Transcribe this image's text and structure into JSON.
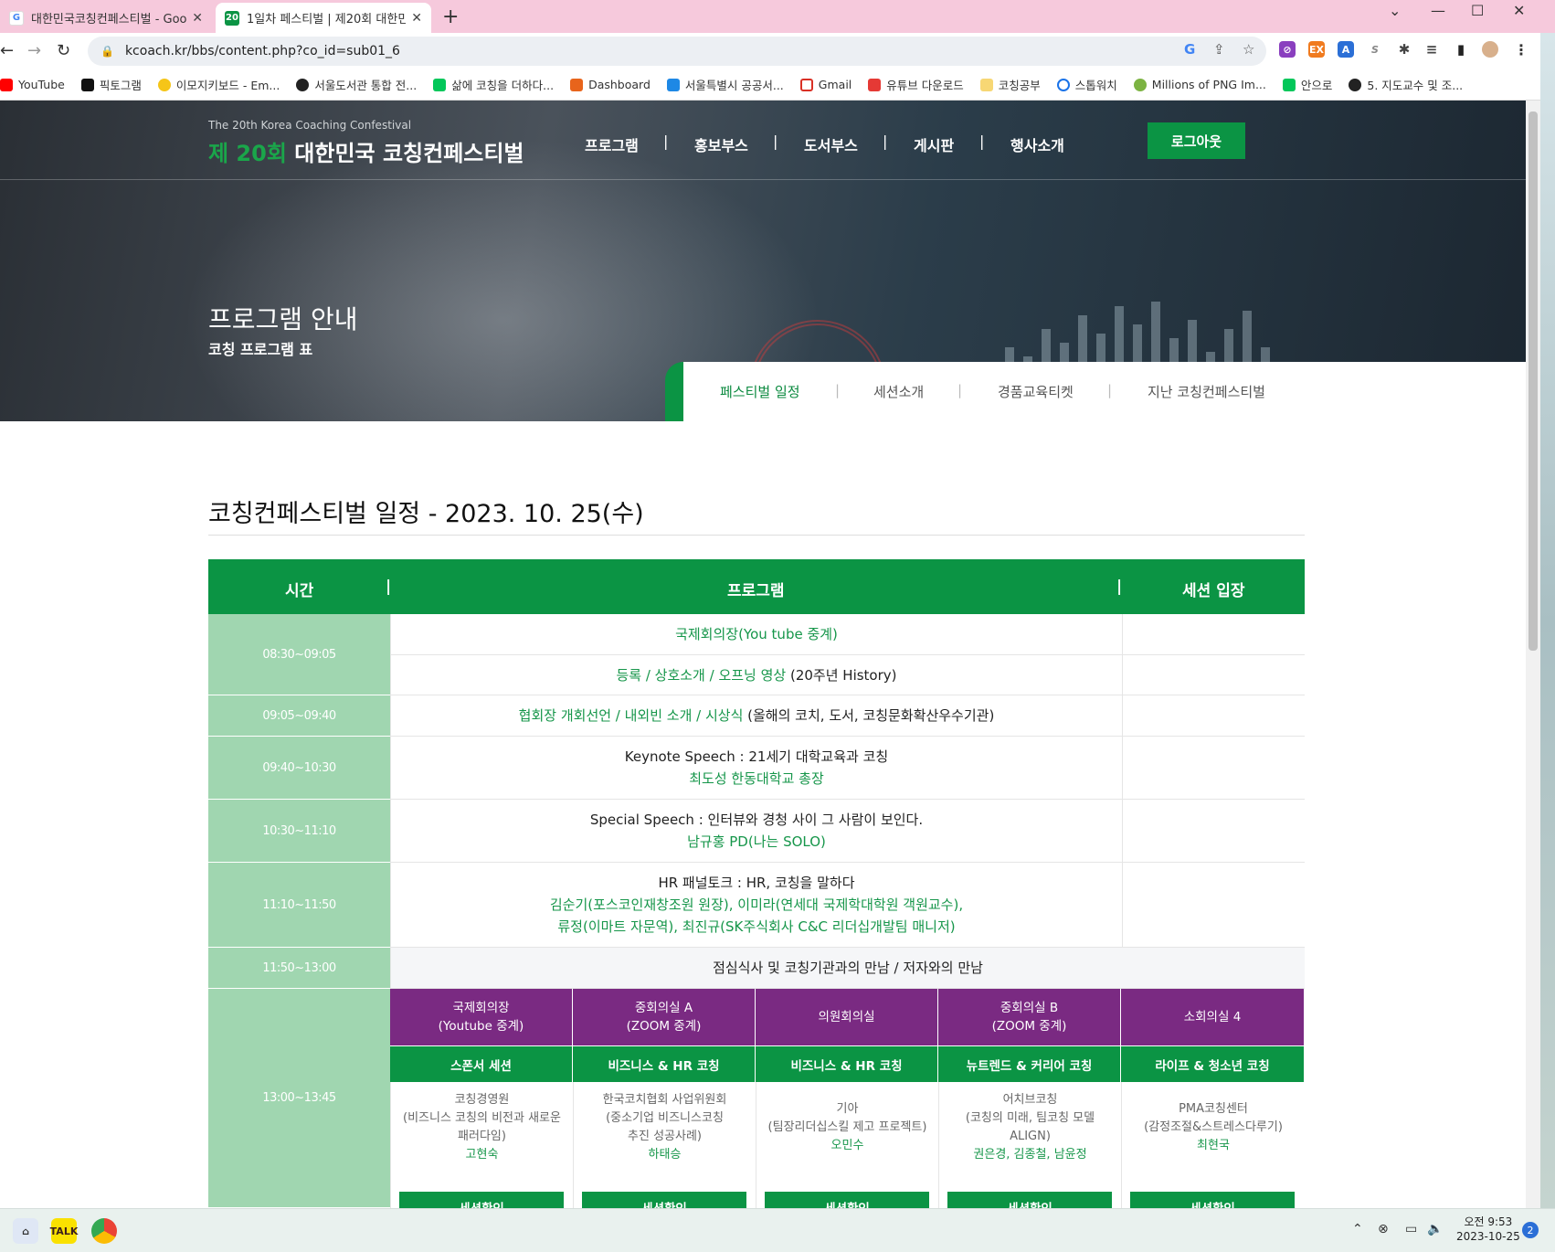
{
  "browser": {
    "tabs": [
      {
        "title": "대한민국코칭컨페스티벌 - Goo",
        "favicon": "G",
        "active": false
      },
      {
        "title": "1일차 페스티벌 | 제20회 대한민",
        "favicon": "20",
        "active": true
      }
    ],
    "new_tab": "+",
    "url": "kcoach.kr/bbs/content.php?co_id=sub01_6",
    "bookmarks": [
      "YouTube",
      "픽토그램",
      "이모지키보드 - Em...",
      "서울도서관 통합 전...",
      "삶에 코칭을 더하다...",
      "Dashboard",
      "서울특별시 공공서...",
      "Gmail",
      "유튜브 다운로드",
      "코칭공부",
      "스톱워치",
      "Millions of PNG Im...",
      "안으로",
      "5. 지도교수 및 조..."
    ],
    "extensions": [
      "G",
      "EX",
      "A",
      "S"
    ]
  },
  "site": {
    "brand_sub": "The 20th Korea Coaching Confestival",
    "brand_num": "제 20회",
    "brand_name": "대한민국 코칭컨페스티벌",
    "nav": [
      "프로그램",
      "홍보부스",
      "도서부스",
      "게시판",
      "행사소개"
    ],
    "nav_sep": "|",
    "logout": "로그아웃",
    "hero_title": "프로그램 안내",
    "hero_sub": "코칭 프로그램 표",
    "subnav": [
      "페스티벌 일정",
      "세션소개",
      "경품교육티켓",
      "지난 코칭컨페스티벌"
    ],
    "subnav_active": "페스티벌 일정"
  },
  "schedule": {
    "title": "코칭컨페스티벌 일정 - 2023. 10. 25(수)",
    "headers": [
      "시간",
      "프로그램",
      "세션 입장"
    ],
    "header_sep": "|",
    "rows": [
      {
        "time": "08:30~09:05",
        "lines": [
          "국제회의장(You tube 중계)"
        ],
        "second": [
          "등록 / 상호소개 / 오프닝 영상",
          " (20주년 History)"
        ]
      },
      {
        "time": "09:05~09:40",
        "lines": [
          "협회장 개회선언 / 내외빈 소개 / 시상식",
          " (올해의 코치, 도서, 코칭문화확산우수기관)"
        ]
      },
      {
        "time": "09:40~10:30",
        "lines": [
          "Keynote Speech : 21세기 대학교육과 코칭",
          "최도성 한동대학교 총장"
        ]
      },
      {
        "time": "10:30~11:10",
        "lines": [
          "Special Speech : 인터뷰와 경청 사이 그 사람이 보인다.",
          "남규홍 PD(나는 SOLO)"
        ]
      },
      {
        "time": "11:10~11:50",
        "lines": [
          "HR 패널토크 : HR, 코칭을 말하다",
          "김순기(포스코인재창조원 원장), 이미라(연세대 국제학대학원 객원교수),",
          "류정(이마트 자문역), 최진규(SK주식회사 C&C 리더십개발팀 매니저)"
        ]
      },
      {
        "time": "11:50~13:00",
        "lines": [
          "점심식사 및 코칭기관과의 만남 / 저자와의 만남"
        ]
      },
      {
        "time": "13:00~13:45"
      }
    ],
    "rooms": [
      {
        "name": "국제회의장",
        "sub": "(Youtube 중계)"
      },
      {
        "name": "중회의실 A",
        "sub": "(ZOOM 중계)"
      },
      {
        "name": "의원회의실",
        "sub": ""
      },
      {
        "name": "중회의실 B",
        "sub": "(ZOOM 중계)"
      },
      {
        "name": "소회의실 4",
        "sub": ""
      }
    ],
    "tracks": [
      "스폰서 세션",
      "비즈니스 & HR 코칭",
      "비즈니스 & HR 코칭",
      "뉴트렌드 & 커리어 코칭",
      "라이프 & 청소년 코칭"
    ],
    "sessions": [
      {
        "org": "코칭경영원",
        "desc": [
          "(비즈니스 코칭의 비전과 새로운",
          "패러다임)"
        ],
        "speaker": "고현숙"
      },
      {
        "org": "한국코치협회 사업위원회",
        "desc": [
          "(중소기업 비즈니스코칭",
          "추진 성공사례)"
        ],
        "speaker": "하태승"
      },
      {
        "org": "기아",
        "desc": [
          "(팀장리더십스킬 제고 프로젝트)"
        ],
        "speaker": "오민수"
      },
      {
        "org": "어치브코칭",
        "desc": [
          "(코칭의 미래, 팀코칭 모델",
          "ALIGN)"
        ],
        "speaker": "권은경, 김종철, 남윤정"
      },
      {
        "org": "PMA코칭센터",
        "desc": [
          "(감정조절&스트레스다루기)"
        ],
        "speaker": "최현국"
      }
    ],
    "session_button": "세션확인"
  },
  "taskbar": {
    "kakao": "TALK",
    "time": "오전 9:53",
    "date": "2023-10-25",
    "notifications": "2"
  },
  "colors": {
    "green": "#0b9444",
    "light_green": "#a0d6b0",
    "purple": "#7a2a82",
    "tab_bar": "#f6c9dc"
  }
}
